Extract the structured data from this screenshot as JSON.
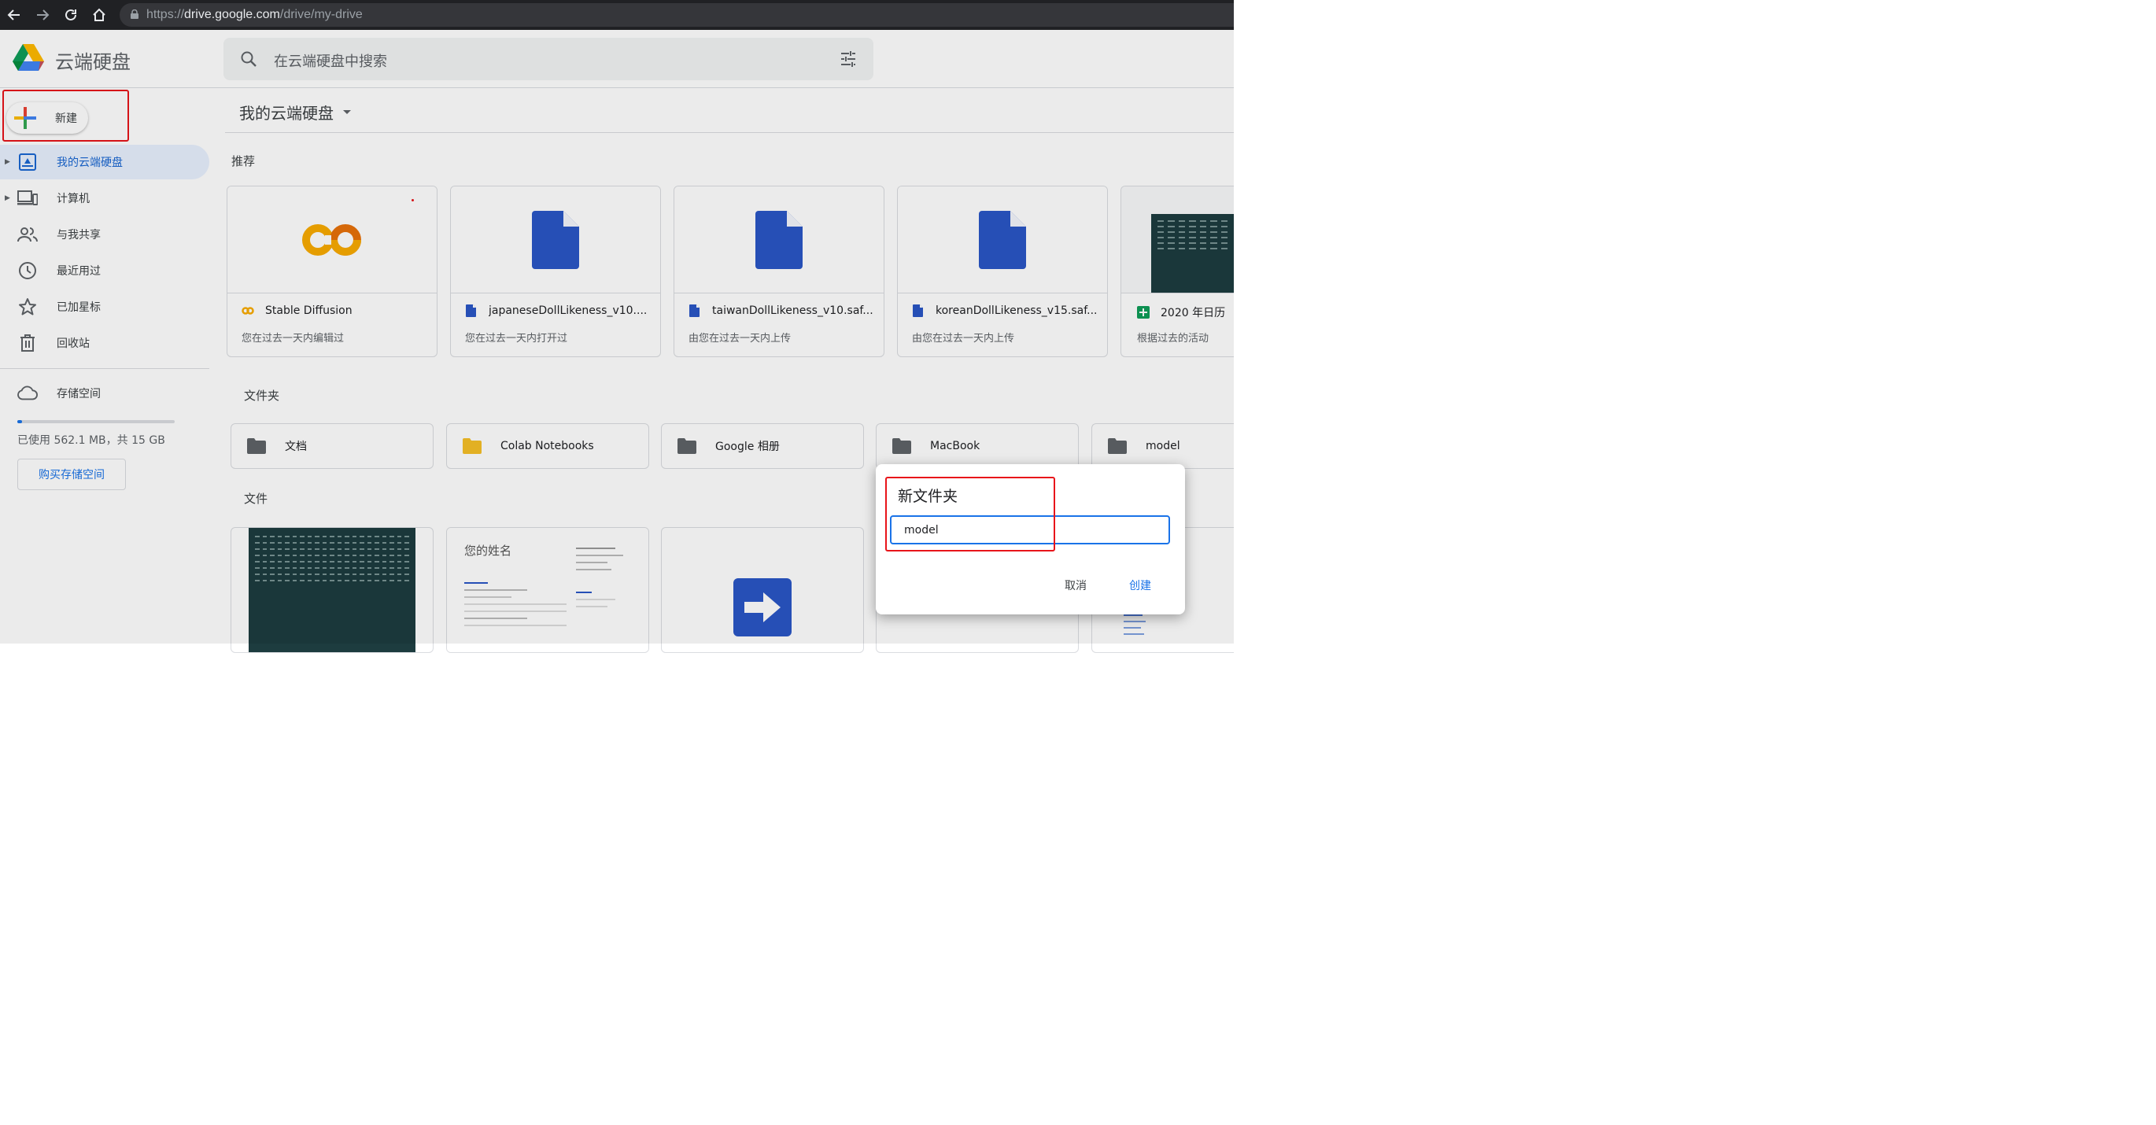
{
  "browser": {
    "url_scheme": "https://",
    "url_host": "drive.google.com",
    "url_path": "/drive/my-drive",
    "icons": [
      "back-icon",
      "forward-icon",
      "reload-icon",
      "home-icon",
      "lock-icon"
    ]
  },
  "header": {
    "app_name": "云端硬盘",
    "search_placeholder": "在云端硬盘中搜索"
  },
  "sidebar": {
    "new_label": "新建",
    "items": [
      {
        "label": "我的云端硬盘",
        "icon": "my-drive-icon",
        "active": true
      },
      {
        "label": "计算机",
        "icon": "computer-icon"
      },
      {
        "label": "与我共享",
        "icon": "shared-icon"
      },
      {
        "label": "最近用过",
        "icon": "clock-icon"
      },
      {
        "label": "已加星标",
        "icon": "star-icon"
      },
      {
        "label": "回收站",
        "icon": "trash-icon"
      }
    ],
    "storage_label": "存储空间",
    "storage_used_text": "已使用 562.1 MB，共 15 GB",
    "storage_fraction": 0.03,
    "buy_label": "购买存储空间"
  },
  "main": {
    "breadcrumb": "我的云端硬盘",
    "suggested_title": "推荐",
    "suggested": [
      {
        "name": "Stable Diffusion",
        "sub": "您在过去一天内编辑过",
        "type": "colab"
      },
      {
        "name": "japaneseDollLikeness_v10....",
        "sub": "您在过去一天内打开过",
        "type": "doc"
      },
      {
        "name": "taiwanDollLikeness_v10.saf...",
        "sub": "由您在过去一天内上传",
        "type": "doc"
      },
      {
        "name": "koreanDollLikeness_v15.saf...",
        "sub": "由您在过去一天内上传",
        "type": "doc"
      },
      {
        "name": "2020 年日历",
        "sub": "根据过去的活动",
        "type": "sheet"
      }
    ],
    "folders_title": "文件夹",
    "folders": [
      {
        "name": "文档",
        "color": "#5f6368"
      },
      {
        "name": "Colab Notebooks",
        "color": "#f6bf26"
      },
      {
        "name": "Google 相册",
        "color": "#5f6368"
      },
      {
        "name": "MacBook",
        "color": "#5f6368"
      },
      {
        "name": "model",
        "color": "#5f6368"
      }
    ],
    "files_title": "文件",
    "resume_name": "您的姓名"
  },
  "dialog": {
    "title": "新文件夹",
    "input_value": "model",
    "cancel_label": "取消",
    "create_label": "创建"
  },
  "colors": {
    "accent": "#1a73e8",
    "highlight_box": "#e8141a",
    "doc_blue": "#2a56c6",
    "calendar_bg": "#1d3c3f"
  }
}
